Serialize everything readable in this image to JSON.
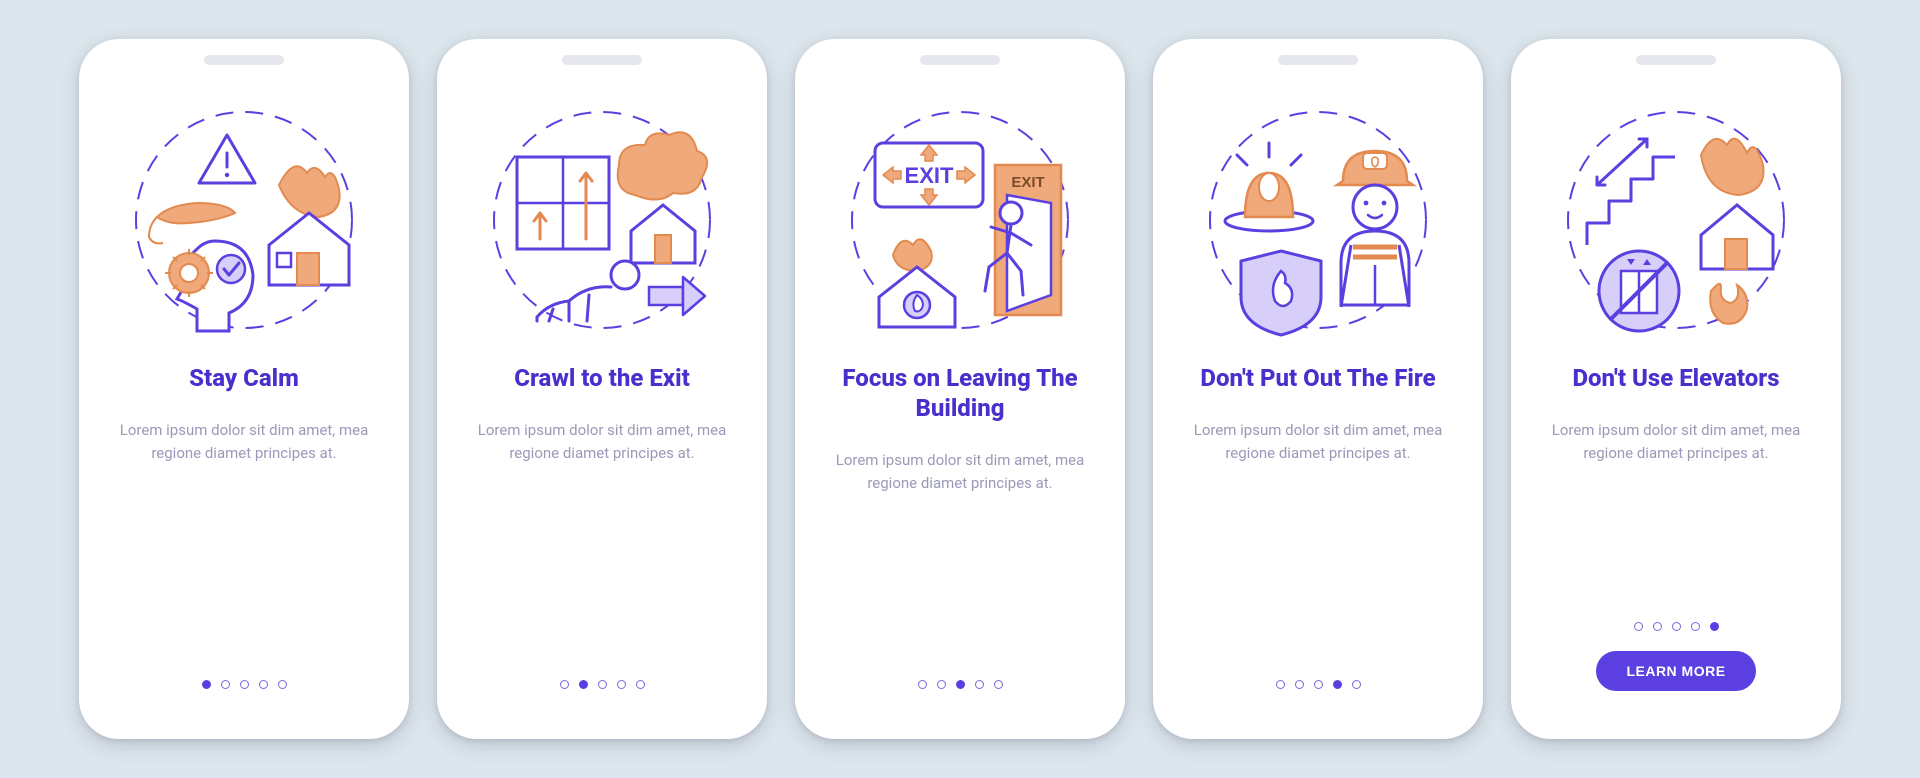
{
  "colors": {
    "purple": "#4b2fcd",
    "accent": "#5b3fe0",
    "orange": "#f0a97a",
    "orange_line": "#e28a4f",
    "bg": "#dce6ec",
    "body_text": "#9a9ab8"
  },
  "cta_label": "LEARN MORE",
  "cards": [
    {
      "title": "Stay Calm",
      "body": "Lorem ipsum dolor sit dim amet, mea regione diamet principes at.",
      "active_index": 0,
      "illus_labels": {
        "warning_icon": "warning-icon",
        "hand_icon": "hand-icon",
        "house_fire_icon": "house-fire-icon",
        "head_gear_icon": "head-gear-check-icon"
      }
    },
    {
      "title": "Crawl to the Exit",
      "body": "Lorem ipsum dolor sit dim amet, mea regione diamet principes at.",
      "active_index": 1,
      "illus_labels": {
        "floor_plan_icon": "floor-plan-icon",
        "smoke_house_icon": "smoke-house-icon",
        "crawl_person_icon": "crawl-person-icon",
        "arrow_icon": "arrow-right-icon"
      }
    },
    {
      "title": "Focus on Leaving The Building",
      "body": "Lorem ipsum dolor sit dim amet, mea regione diamet principes at.",
      "active_index": 2,
      "illus_labels": {
        "exit_sign_icon": "exit-sign-icon",
        "exit_door_icon": "exit-door-icon",
        "running_person_icon": "running-person-icon",
        "house_fire_small_icon": "house-fire-small-icon",
        "exit_sign_text": "EXIT",
        "exit_door_text": "EXIT"
      }
    },
    {
      "title": "Don't Put Out The Fire",
      "body": "Lorem ipsum dolor sit dim amet, mea regione diamet principes at.",
      "active_index": 3,
      "illus_labels": {
        "siren_icon": "siren-icon",
        "firefighter_icon": "firefighter-icon",
        "fire_shield_icon": "fire-shield-icon"
      }
    },
    {
      "title": "Don't Use Elevators",
      "body": "Lorem ipsum dolor sit dim amet, mea regione diamet principes at.",
      "active_index": 4,
      "illus_labels": {
        "stairs_icon": "stairs-icon",
        "fire_house_icon": "fire-house-icon",
        "no_elevator_icon": "no-elevator-icon",
        "flame_icon": "flame-icon"
      }
    }
  ],
  "dots_total": 5
}
